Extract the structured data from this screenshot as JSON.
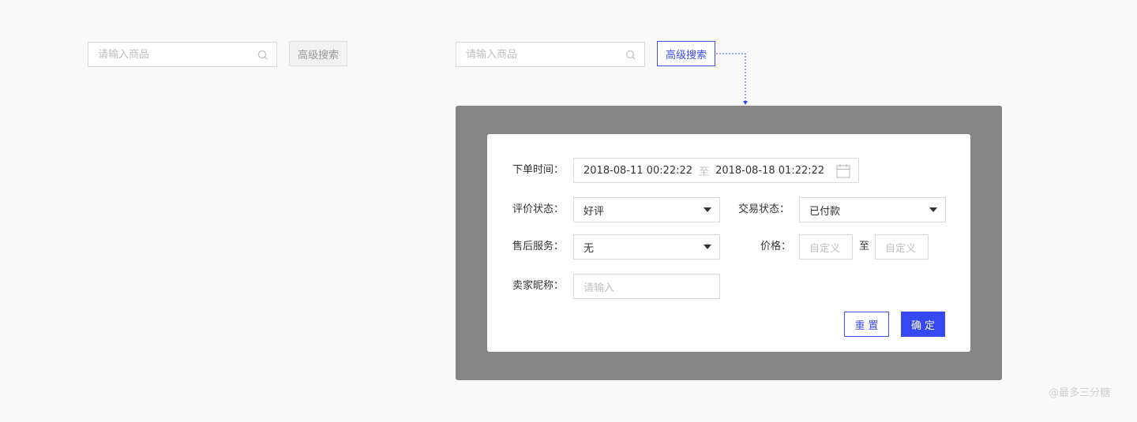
{
  "left": {
    "search_placeholder": "请输入商品",
    "advanced_label": "高级搜索"
  },
  "right": {
    "search_placeholder": "请输入商品",
    "advanced_label": "高级搜索"
  },
  "panel": {
    "order_time_label": "下单时间：",
    "date_start": "2018-08-11 00:22:22",
    "date_separator": "至",
    "date_end": "2018-08-18 01:22:22",
    "rating_label": "评价状态：",
    "rating_value": "好评",
    "trade_label": "交易状态：",
    "trade_value": "已付款",
    "aftersale_label": "售后服务：",
    "aftersale_value": "无",
    "price_label": "价格：",
    "price_min_placeholder": "自定义",
    "price_separator": "至",
    "price_max_placeholder": "自定义",
    "seller_label": "卖家昵称：",
    "seller_placeholder": "请输入",
    "reset_label": "重置",
    "confirm_label": "确定"
  },
  "watermark": "@最多三分糖",
  "colors": {
    "accent": "#3d4ee8",
    "primary_button": "#3548f2",
    "overlay": "#858585",
    "background": "#f9f9f9"
  }
}
